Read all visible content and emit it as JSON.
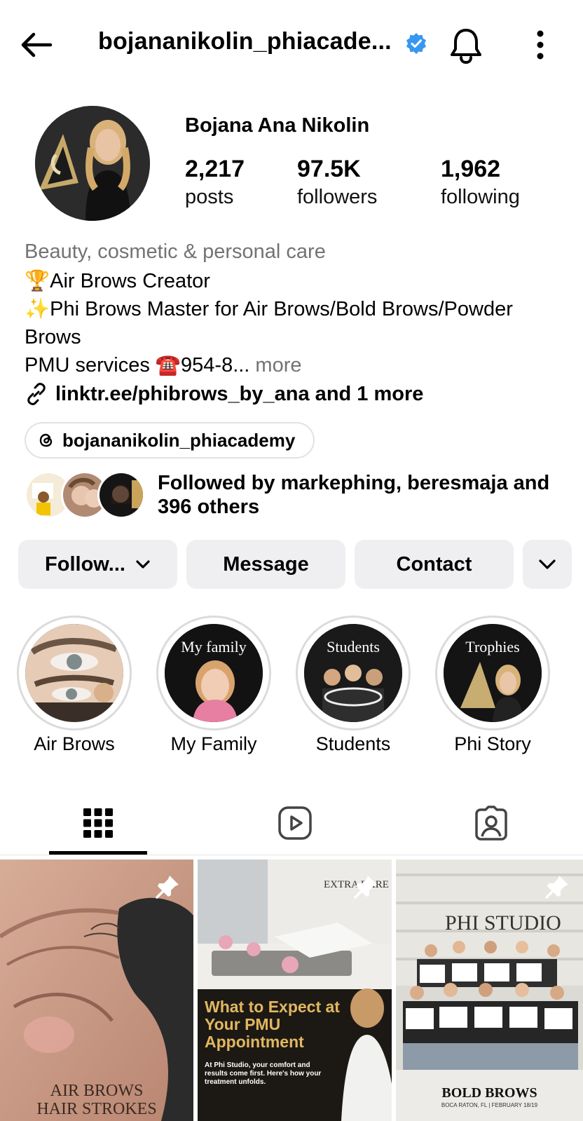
{
  "header": {
    "username": "bojananikolin_phiacade...",
    "verified": true,
    "icons": [
      "back-arrow-icon",
      "verified-badge-icon",
      "bell-icon",
      "more-vertical-icon"
    ]
  },
  "profile": {
    "full_name": "Bojana Ana Nikolin",
    "stats": {
      "posts_value": "2,217",
      "posts_label": "posts",
      "followers_value": "97.5K",
      "followers_label": "followers",
      "following_value": "1,962",
      "following_label": "following"
    },
    "category": "Beauty, cosmetic & personal care",
    "bio_line1": "🏆Air Brows Creator",
    "bio_line2": "✨Phi Brows Master for Air Brows/Bold Brows/Powder Brows",
    "bio_line3": "PMU services ☎️954-8...",
    "bio_more": " more",
    "link": "linktr.ee/phibrows_by_ana and 1 more",
    "threads_handle": "bojananikolin_phiacademy",
    "followed_by": "Followed by markephing, beresmaja and 396 others"
  },
  "actions": {
    "follow_label": "Follow...",
    "message_label": "Message",
    "contact_label": "Contact"
  },
  "highlights": [
    {
      "label": "Air Brows",
      "cover_text": ""
    },
    {
      "label": "My Family",
      "cover_text": "My family"
    },
    {
      "label": "Students",
      "cover_text": "Students"
    },
    {
      "label": "Phi Story",
      "cover_text": "Trophies"
    }
  ],
  "tabs": [
    "grid-icon",
    "reels-icon",
    "tagged-icon"
  ],
  "posts": [
    {
      "caption": "AIR BROWS\nHAIR STROKES",
      "pinned": true
    },
    {
      "title": "What to Expect at Your PMU Appointment",
      "body": "At Phi Studio, your comfort and results come first. Here's how your treatment unfolds.",
      "wall_sign": "EXTRA RARE",
      "pinned": true
    },
    {
      "wall_sign": "PHI STUDIO",
      "footer_title": "BOLD BROWS",
      "footer_sub": "BOCA RATON, FL | FEBRUARY 18/19",
      "pinned": true
    }
  ],
  "colors": {
    "verified_blue": "#3897f0",
    "button_bg": "#efeff2",
    "muted_text": "#737373",
    "ring": "#dbdbdb"
  }
}
